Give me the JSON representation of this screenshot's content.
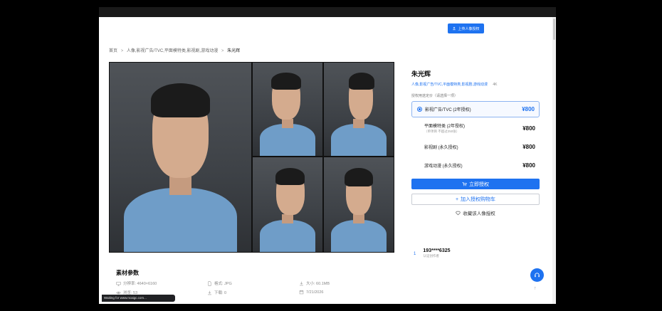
{
  "header": {
    "upload_label": "上传人像授权"
  },
  "breadcrumb": {
    "home": "首页",
    "sep": ">",
    "category": "人像,影视广告/TVC,平面模特类,影视剧,游戏动漫",
    "current": "朱光辉"
  },
  "product": {
    "name": "朱光辉",
    "tags": "人像,影视广告/TVC,平面模特类,影视剧,游戏动漫",
    "resolution": "4K",
    "choose_label": "授权用途定价（请选择一项）",
    "options": [
      {
        "label": "影视广告/TVC (2年授权)",
        "sub": "",
        "price": "¥800",
        "selected": true
      },
      {
        "label": "平面模特类 (2年授权)",
        "sub": "（单项目 不超过250张）",
        "price": "¥800",
        "selected": false
      },
      {
        "label": "影视剧 (永久授权)",
        "sub": "",
        "price": "¥800",
        "selected": false
      },
      {
        "label": "游戏动漫 (永久授权)",
        "sub": "",
        "price": "¥800",
        "selected": false
      }
    ],
    "buy_label": "立即授权",
    "cart_label": "加入授权购物车",
    "fav_label": "收藏该人像授权"
  },
  "author": {
    "index": "1",
    "phone": "193****6325",
    "role": "认证创作者"
  },
  "params": {
    "title": "素材参数",
    "resolution": "分辨率: 4640×6160",
    "format": "格式: JPG",
    "size": "大小: 60.1MB",
    "views": "浏览: 53",
    "downloads": "下载: 0",
    "date": "7/21/2026"
  },
  "status_text": "Waiting for www.ncaigc.com...",
  "colors": {
    "accent": "#1e72f0",
    "shirt": "#6f9dc8",
    "backdrop": "#45494e"
  }
}
